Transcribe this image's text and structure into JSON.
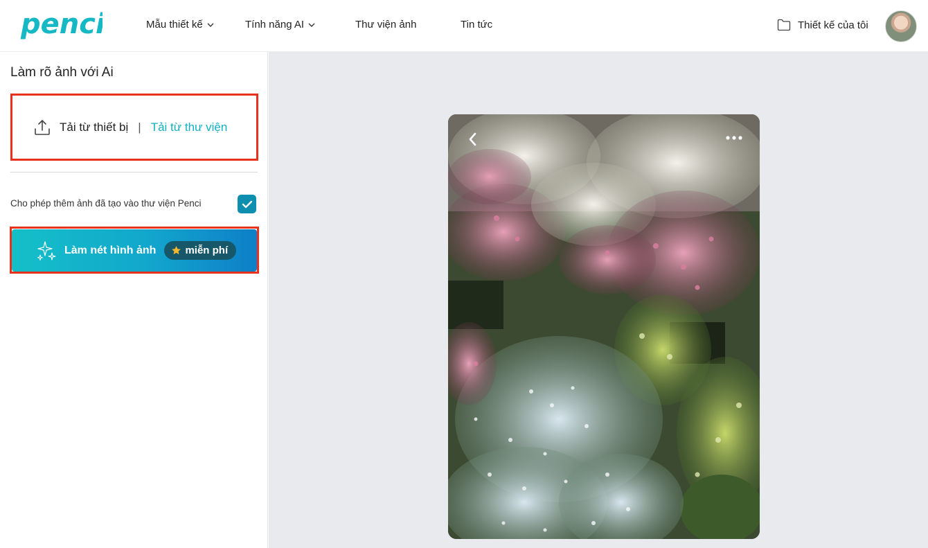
{
  "brand": {
    "logo_text": "penci",
    "accent": "#16b8c4"
  },
  "nav": {
    "items": [
      {
        "label": "Mẫu thiết kế",
        "has_dropdown": true
      },
      {
        "label": "Tính năng AI",
        "has_dropdown": true
      },
      {
        "label": "Thư viện ảnh",
        "has_dropdown": false
      },
      {
        "label": "Tin tức",
        "has_dropdown": false
      }
    ],
    "my_designs": "Thiết kế của tôi",
    "my_designs_icon": "folder-icon"
  },
  "sidebar": {
    "title": "Làm rõ ảnh với Ai",
    "upload": {
      "device_label": "Tải từ thiết bị",
      "separator": "|",
      "library_label": "Tải từ thư viện",
      "icon": "upload-icon"
    },
    "allow_label": "Cho phép thêm ảnh đã tạo vào thư viện Penci",
    "allow_checked": true,
    "cta": {
      "label": "Làm nét hình ảnh",
      "badge": "miễn phí",
      "icon": "sparkle-icon",
      "badge_icon": "star-icon"
    }
  },
  "preview": {
    "back_icon": "chevron-left-icon",
    "more_icon": "more-horizontal-icon"
  },
  "colors": {
    "highlight_border": "#e8321e",
    "link": "#12b0c2",
    "checkbox": "#0e8fb0",
    "canvas_bg": "#e9eaee"
  }
}
